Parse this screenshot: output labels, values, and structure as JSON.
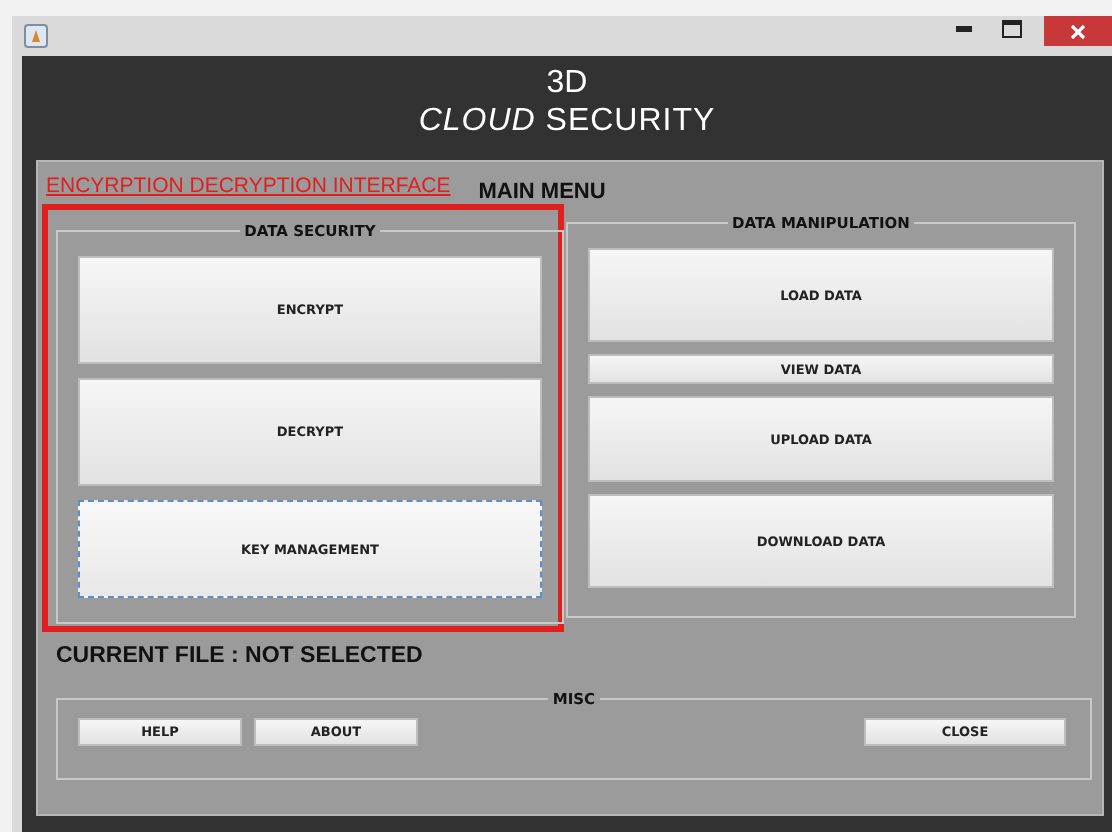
{
  "header": {
    "line_1": "3D",
    "line_2": "*CLOUD* SECURITY"
  },
  "interface_link": "ENCYRPTION DECRYPTION INTERFACE",
  "menu_title": "MAIN MENU",
  "data_security": {
    "title": "DATA SECURITY",
    "buttons": [
      {
        "label": "ENCRYPT",
        "focused": false
      },
      {
        "label": "DECRYPT",
        "focused": false
      },
      {
        "label": "KEY MANAGEMENT",
        "focused": true
      }
    ]
  },
  "data_manipulation": {
    "title": "DATA MANIPULATION",
    "buttons": [
      {
        "label": "LOAD DATA"
      },
      {
        "label": "VIEW DATA"
      },
      {
        "label": "UPLOAD DATA"
      },
      {
        "label": "DOWNLOAD DATA"
      }
    ]
  },
  "current_file": "CURRENT FILE : NOT SELECTED",
  "misc": {
    "title": "MISC",
    "buttons": [
      {
        "label": "HELP"
      },
      {
        "label": "ABOUT"
      },
      {
        "label": "CLOSE"
      }
    ]
  }
}
